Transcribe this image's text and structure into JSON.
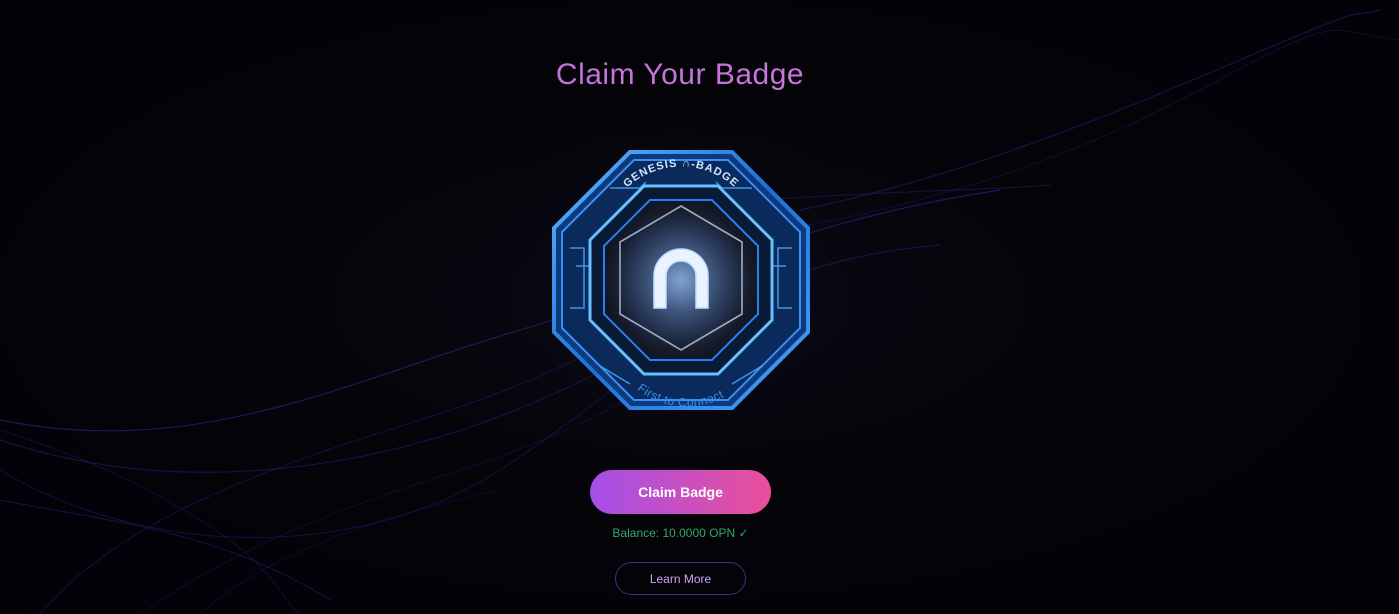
{
  "page": {
    "title": "Claim Your Badge"
  },
  "badge": {
    "top_text": "GENESIS ∩-BADGE",
    "bottom_text": "First to Connect",
    "logo_icon": "n-arch-icon"
  },
  "actions": {
    "claim_label": "Claim Badge",
    "learn_more_label": "Learn More"
  },
  "status": {
    "balance_text": "Balance: 10.0000 OPN ✓"
  },
  "colors": {
    "accent_start": "#a44fea",
    "accent_end": "#ea4f99",
    "balance": "#2ea86a",
    "badge_blue": "#2f8cff"
  }
}
